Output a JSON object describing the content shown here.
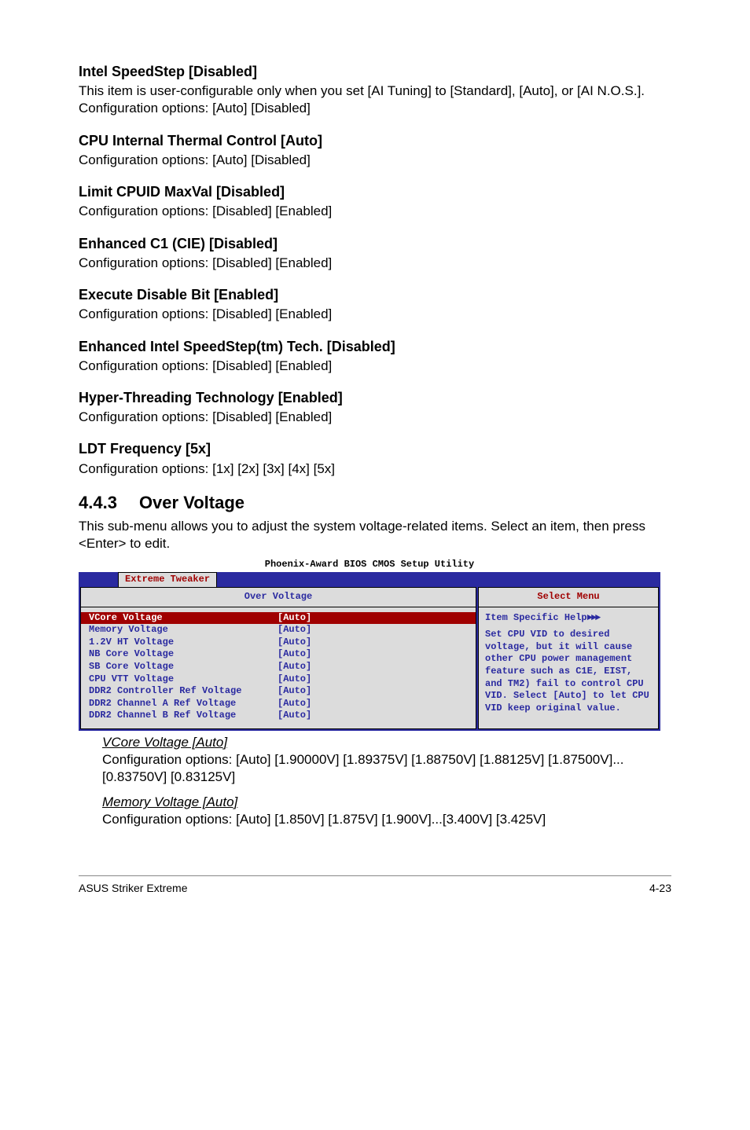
{
  "sections": [
    {
      "title": "Intel SpeedStep [Disabled]",
      "body": "This item is user-configurable only when you set [AI Tuning] to [Standard], [Auto], or [AI N.O.S.]. Configuration options: [Auto] [Disabled]"
    },
    {
      "title": "CPU Internal Thermal Control [Auto]",
      "body": "Configuration options: [Auto] [Disabled]"
    },
    {
      "title": "Limit CPUID MaxVal [Disabled]",
      "body": "Configuration options: [Disabled] [Enabled]"
    },
    {
      "title": "Enhanced C1 (CIE) [Disabled]",
      "body": "Configuration options: [Disabled] [Enabled]"
    },
    {
      "title": "Execute Disable Bit [Enabled]",
      "body": "Configuration options: [Disabled] [Enabled]"
    },
    {
      "title": "Enhanced Intel SpeedStep(tm) Tech. [Disabled]",
      "body": "Configuration options: [Disabled] [Enabled]"
    },
    {
      "title": "Hyper-Threading Technology [Enabled]",
      "body": "Configuration options: [Disabled] [Enabled]"
    },
    {
      "title": "LDT Frequency [5x]",
      "body": "Configuration options: [1x] [2x] [3x] [4x] [5x]"
    }
  ],
  "subhead": {
    "num": "4.4.3",
    "title": "Over Voltage"
  },
  "subhead_body": "This sub-menu allows you to adjust the system voltage-related items. Select an item, then press <Enter> to edit.",
  "bios": {
    "title": "Phoenix-Award BIOS CMOS Setup Utility",
    "tab": "Extreme Tweaker",
    "left_head": "Over Voltage",
    "right_head": "Select Menu",
    "rows": [
      {
        "label": "VCore Voltage",
        "value": "[Auto]",
        "selected": true
      },
      {
        "label": "Memory Voltage",
        "value": "[Auto]"
      },
      {
        "label": "1.2V HT Voltage",
        "value": "[Auto]"
      },
      {
        "label": "NB Core Voltage",
        "value": "[Auto]"
      },
      {
        "label": "SB Core Voltage",
        "value": "[Auto]"
      },
      {
        "label": "CPU VTT Voltage",
        "value": "[Auto]"
      },
      {
        "label": "DDR2 Controller Ref Voltage",
        "value": "[Auto]"
      },
      {
        "label": "DDR2 Channel A Ref Voltage",
        "value": "[Auto]"
      },
      {
        "label": "DDR2 Channel B Ref Voltage",
        "value": "[Auto]"
      }
    ],
    "help_title": "Item Specific Help",
    "help_body": "Set CPU VID to desired voltage, but it will cause other CPU power management feature such as C1E, EIST, and TM2) fail to control CPU VID. Select [Auto] to let CPU VID keep original value."
  },
  "under_items": [
    {
      "title": "VCore Voltage [Auto]",
      "body": "Configuration options: [Auto] [1.90000V] [1.89375V] [1.88750V] [1.88125V] [1.87500V]...[0.83750V] [0.83125V]"
    },
    {
      "title": "Memory Voltage [Auto]",
      "body": "Configuration options: [Auto] [1.850V] [1.875V] [1.900V]...[3.400V] [3.425V]"
    }
  ],
  "footer": {
    "left": "ASUS Striker Extreme",
    "right": "4-23"
  }
}
